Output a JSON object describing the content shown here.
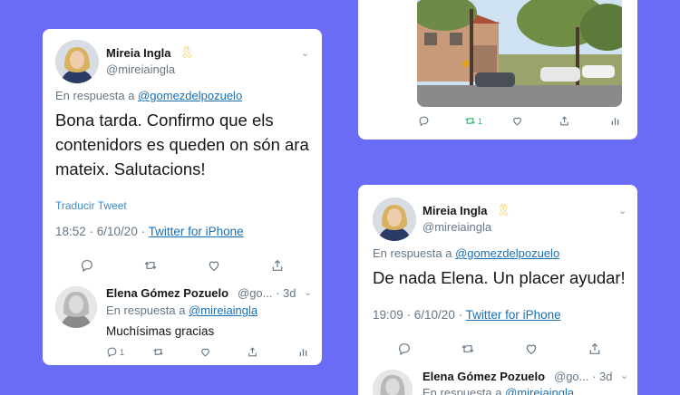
{
  "left_card": {
    "author_name": "Mireia Ingla",
    "author_handle": "@mireiaingla",
    "reply_prefix": "En respuesta a",
    "reply_to": "@gomezdelpozuelo",
    "text_line1": "Bona tarda. Confirmo que els",
    "text_line2": "contenidors es queden on són ara",
    "text_line3": "mateix. Salutacions!",
    "translate": "Traducir Tweet",
    "time": "18:52 · 6/10/20 ·",
    "source": "Twitter for iPhone",
    "reply": {
      "author_name": "Elena Gómez Pozuelo",
      "author_meta": "@go... · 3d",
      "reply_prefix": "En respuesta a",
      "reply_to": "@mireiaingla",
      "text": "Muchísimas gracias",
      "reply_count": "1"
    }
  },
  "top_right_card": {
    "retweet_count": "1"
  },
  "bottom_right_card": {
    "author_name": "Mireia Ingla",
    "author_handle": "@mireiaingla",
    "reply_prefix": "En respuesta a",
    "reply_to": "@gomezdelpozuelo",
    "text": "De nada Elena. Un placer ayudar!",
    "time": "19:09 · 6/10/20 ·",
    "source": "Twitter for iPhone",
    "reply": {
      "author_name": "Elena Gómez Pozuelo",
      "author_meta": "@go... · 3d",
      "reply_prefix": "En respuesta a",
      "reply_to": "@mireiaingla"
    }
  },
  "colors": {
    "background": "#6b6cf6",
    "link": "#1b6fb3",
    "muted": "#657786",
    "retweet_active": "#17bf63"
  },
  "icons": [
    "reply-icon",
    "retweet-icon",
    "like-icon",
    "share-icon",
    "analytics-icon",
    "chevron-down-icon",
    "yellow-ribbon-icon"
  ]
}
